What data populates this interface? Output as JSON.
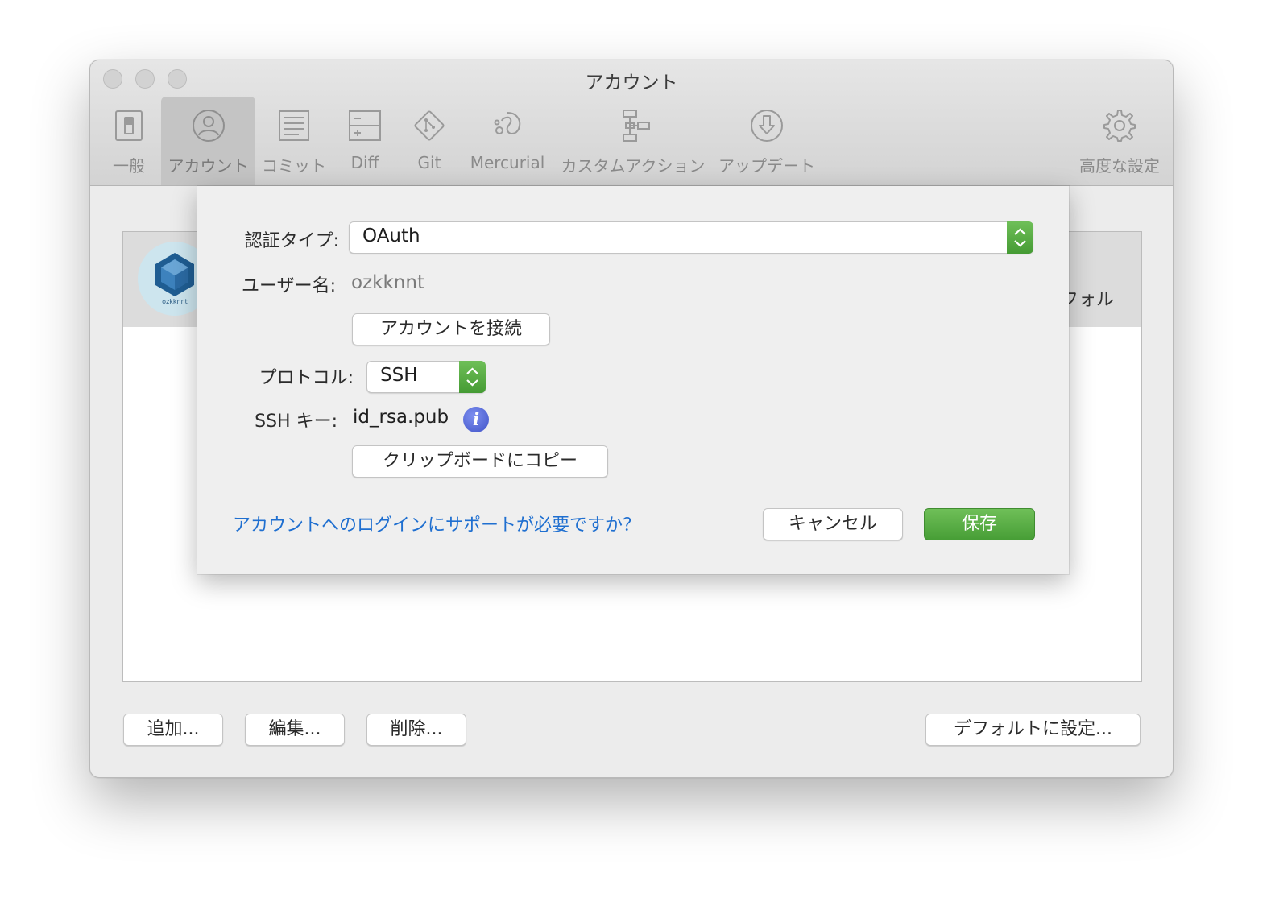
{
  "window": {
    "title": "アカウント"
  },
  "toolbar": {
    "tabs": [
      {
        "label": "一般",
        "icon": "toggle-switch-icon"
      },
      {
        "label": "アカウント",
        "icon": "person-circle-icon",
        "selected": true
      },
      {
        "label": "コミット",
        "icon": "document-lines-icon"
      },
      {
        "label": "Diff",
        "icon": "diff-icon"
      },
      {
        "label": "Git",
        "icon": "git-icon"
      },
      {
        "label": "Mercurial",
        "icon": "mercurial-icon"
      },
      {
        "label": "カスタムアクション",
        "icon": "custom-actions-icon"
      },
      {
        "label": "アップデート",
        "icon": "download-circle-icon"
      },
      {
        "label": "高度な設定",
        "icon": "gear-icon"
      }
    ]
  },
  "accounts": {
    "avatar_caption": "ozkknnt",
    "default_label_partial": "フォル"
  },
  "sheet": {
    "auth_type_label": "認証タイプ:",
    "auth_type_value": "OAuth",
    "username_label": "ユーザー名:",
    "username_value": "ozkknnt",
    "connect_button": "アカウントを接続",
    "protocol_label": "プロトコル:",
    "protocol_value": "SSH",
    "ssh_key_label": "SSH キー:",
    "ssh_key_value": "id_rsa.pub",
    "info_glyph": "i",
    "copy_button": "クリップボードにコピー",
    "help_link": "アカウントへのログインにサポートが必要ですか？",
    "cancel_button": "キャンセル",
    "save_button": "保存"
  },
  "bottom": {
    "add_button": "追加...",
    "edit_button": "編集...",
    "delete_button": "削除...",
    "set_default_button": "デフォルトに設定..."
  },
  "colors": {
    "accent_green": "#4fa63d",
    "link_blue": "#1f6fd0",
    "info_blue": "#4f62d8"
  }
}
